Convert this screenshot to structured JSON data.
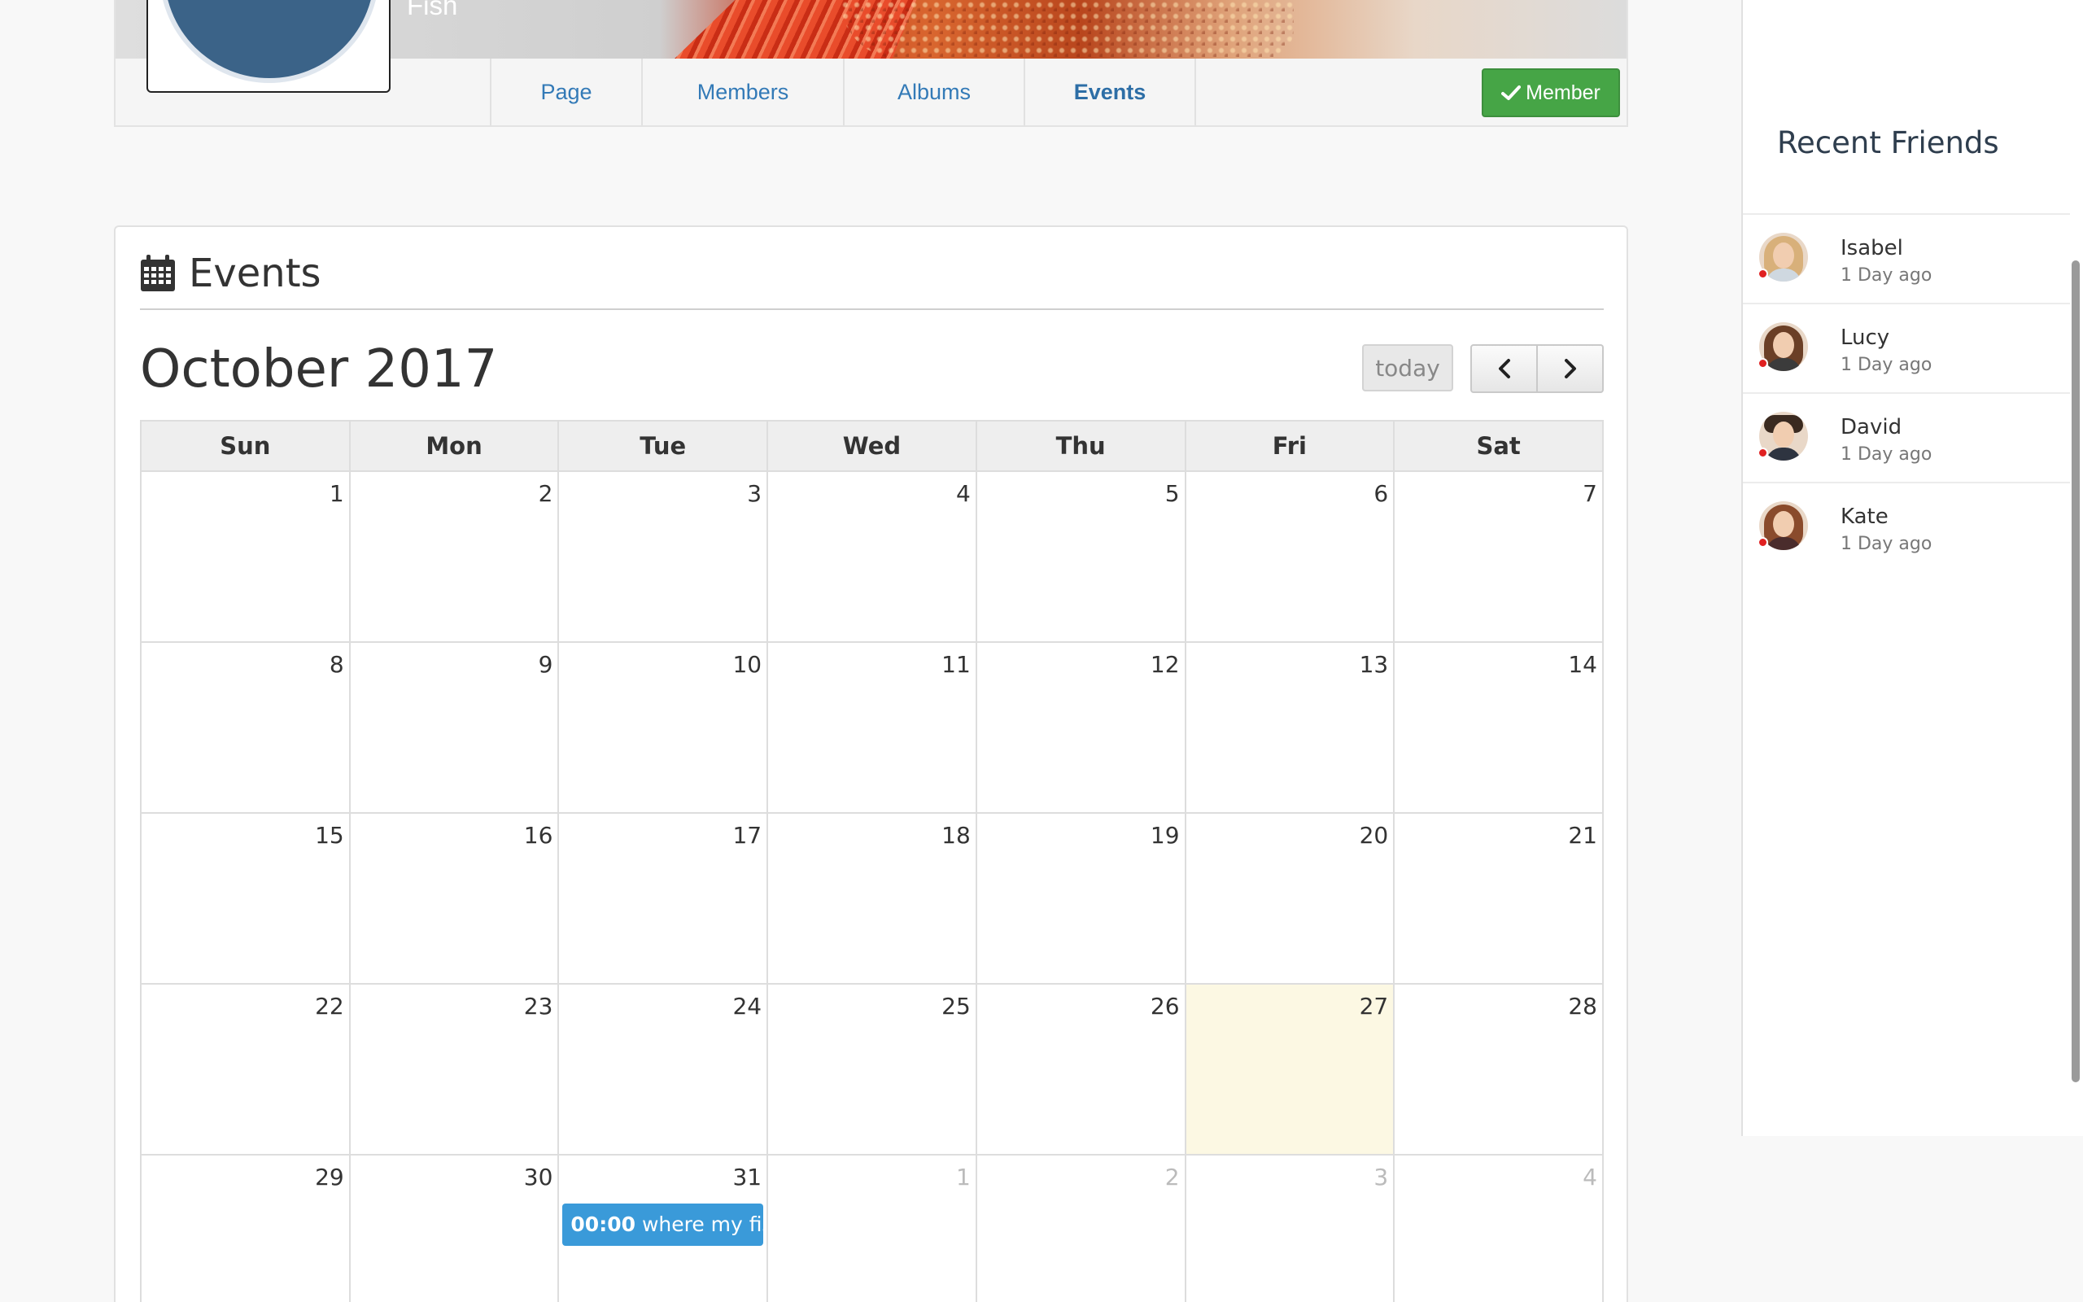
{
  "group": {
    "name": "Fish",
    "nav": [
      {
        "label": "Page"
      },
      {
        "label": "Members"
      },
      {
        "label": "Albums"
      },
      {
        "label": "Events"
      }
    ],
    "member_button": "Member"
  },
  "events": {
    "heading": "Events",
    "calendar_title": "October 2017",
    "today_label": "today",
    "weekdays": [
      "Sun",
      "Mon",
      "Tue",
      "Wed",
      "Thu",
      "Fri",
      "Sat"
    ],
    "weeks": [
      [
        "1",
        "2",
        "3",
        "4",
        "5",
        "6",
        "7"
      ],
      [
        "8",
        "9",
        "10",
        "11",
        "12",
        "13",
        "14"
      ],
      [
        "15",
        "16",
        "17",
        "18",
        "19",
        "20",
        "21"
      ],
      [
        "22",
        "23",
        "24",
        "25",
        "26",
        "27",
        "28"
      ],
      [
        "29",
        "30",
        "31",
        "1",
        "2",
        "3",
        "4"
      ]
    ],
    "event": {
      "time": "00:00",
      "title": "where my fish"
    }
  },
  "sidebar": {
    "title": "Recent Friends",
    "friends": [
      {
        "name": "Isabel",
        "time": "1 Day ago"
      },
      {
        "name": "Lucy",
        "time": "1 Day ago"
      },
      {
        "name": "David",
        "time": "1 Day ago"
      },
      {
        "name": "Kate",
        "time": "1 Day ago"
      }
    ]
  },
  "colors": {
    "link": "#337ab7",
    "member_button": "#46a546",
    "event": "#3a9ad9",
    "today_cell": "#fcf8e3",
    "online_status": "#e02020"
  }
}
